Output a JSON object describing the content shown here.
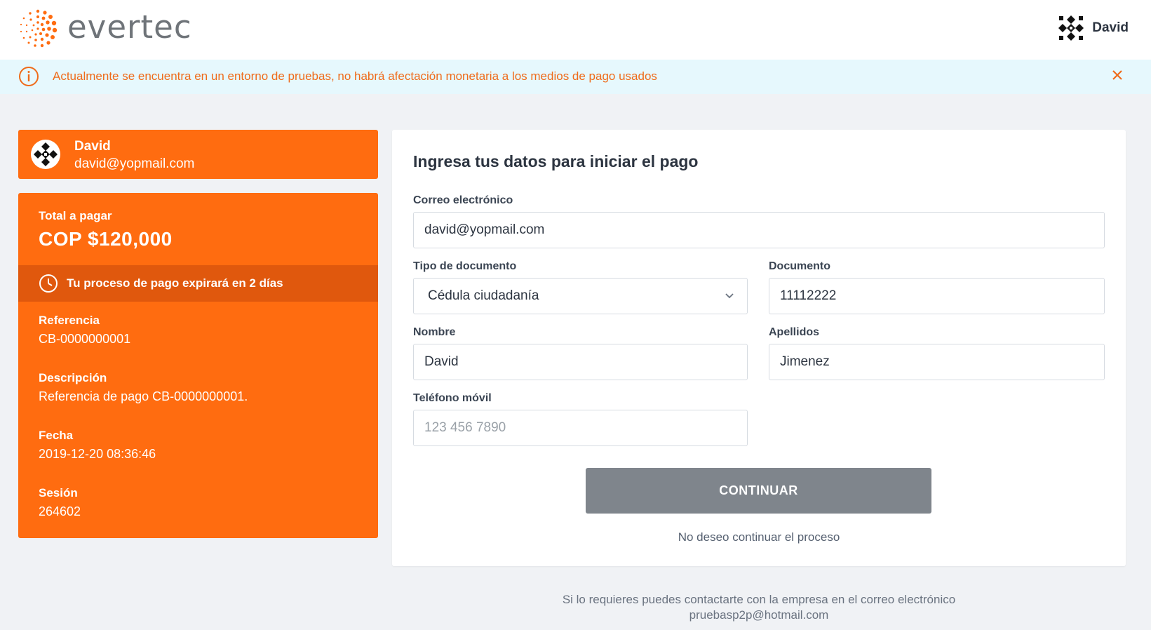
{
  "brand": {
    "name": "evertec",
    "trademark": "®",
    "accent": "#ff6c10"
  },
  "header": {
    "user_name": "David",
    "avatar_icon": "geometric-avatar-icon"
  },
  "banner": {
    "message": "Actualmente se encuentra en un entorno de pruebas, no habrá afectación monetaria a los medios de pago usados",
    "info_icon": "info-circle-icon",
    "close_icon": "close-icon"
  },
  "user_card": {
    "name": "David",
    "email": "david@yopmail.com"
  },
  "payment": {
    "total_label": "Total a pagar",
    "total_value": "COP $120,000",
    "expiry_text": "Tu proceso de pago expirará en 2 días",
    "reference_label": "Referencia",
    "reference_value": "CB-0000000001",
    "description_label": "Descripción",
    "description_value": "Referencia de pago CB-0000000001.",
    "date_label": "Fecha",
    "date_value": "2019-12-20 08:36:46",
    "session_label": "Sesión",
    "session_value": "264602"
  },
  "form": {
    "title": "Ingresa tus datos para iniciar el pago",
    "email_label": "Correo electrónico",
    "email_value": "david@yopmail.com",
    "doc_type_label": "Tipo de documento",
    "doc_type_value": "Cédula ciudadanía",
    "document_label": "Documento",
    "document_value": "11112222",
    "name_label": "Nombre",
    "name_value": "David",
    "lastname_label": "Apellidos",
    "lastname_value": "Jimenez",
    "phone_label": "Teléfono móvil",
    "phone_placeholder": "123 456 7890",
    "continue_label": "CONTINUAR",
    "cancel_label": "No deseo continuar el proceso"
  },
  "footer": {
    "line1": "Si lo requieres puedes contactarte con la empresa en el correo electrónico",
    "line2": "pruebasp2p@hotmail.com"
  }
}
